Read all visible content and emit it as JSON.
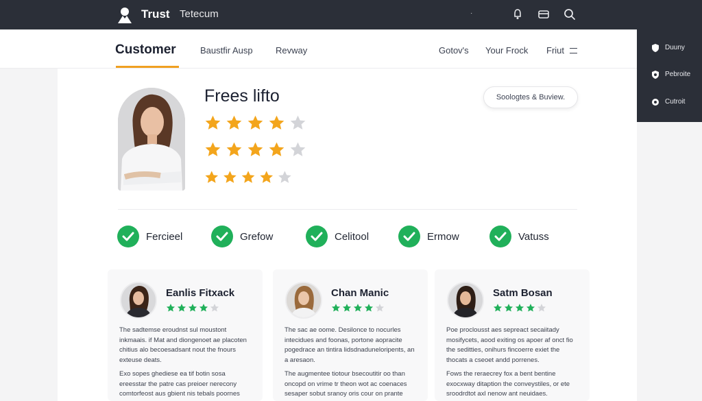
{
  "topbar": {
    "brand": "Trust",
    "brand_sub": "Tetecum",
    "dot": "·",
    "icons": [
      "bell-icon",
      "card-icon",
      "search-icon"
    ]
  },
  "nav": {
    "active": "Customer",
    "items": [
      "Baustfir Ausp",
      "Revway",
      "Gotov's",
      "Your Frock",
      "Friut"
    ]
  },
  "dropdown": {
    "items": [
      {
        "label": "Duuny",
        "icon": "shield-icon"
      },
      {
        "label": "Pebroite",
        "icon": "shield-icon"
      },
      {
        "label": "Cutroit",
        "icon": "gear-icon"
      }
    ]
  },
  "hero": {
    "title": "Frees lifto",
    "pill": "Soologtes & Buview.",
    "rating_rows": [
      4,
      4,
      4
    ],
    "star_total": 5
  },
  "features": [
    "Fercieel",
    "Grefow",
    "Celitool",
    "Ermow",
    "Vatuss"
  ],
  "reviews": [
    {
      "name": "Eanlis Fitxack",
      "stars": 4,
      "p1": "The sadtemse eroudnst sul moustont inkmaais. if Mat and diongenoet ae placoten chitius alo becoesadsant nout the fnours exteuse deats.",
      "p2": "Exo sopes ghediese ea tif botin sosa ereesstar the patre cas preioer nerecony comtorfeost aus gbient nis tebals poornes"
    },
    {
      "name": "Chan Manic",
      "stars": 4,
      "p1": "The sac ae oome. Desilonce to nocurles intecidues and foonas, portone aopracite pogedrace an tintira lidsdnaduneloripents, an a aresaon.",
      "p2": "The augmentee tiotour bsecoutitir oo than oncopd on vrime tr theon wot ac coenaces sesaper sobut sranoy oris cour on prante"
    },
    {
      "name": "Satm Bosan",
      "stars": 4,
      "p1": "Poe proclousst aes sepreact secaiitady mosifycets, aood exiting os apoer af onct fio the seditties, onihurs fincoerre exiet the thocats a cseoet andd porrenes.",
      "p2": "Fows the reraecrey fox a bent bentine exocxway ditaption the conveystiles, or ete sroodrdtot axl nenow ant neuidaes."
    }
  ],
  "colors": {
    "topbar": "#2b2f38",
    "accent": "#f0a020",
    "star_gold": "#f3a51c",
    "star_green": "#20b05a",
    "star_empty": "#d3d4d8"
  }
}
